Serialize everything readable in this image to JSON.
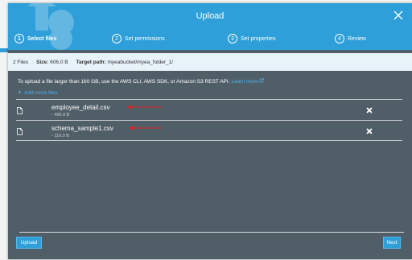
{
  "modal": {
    "title": "Upload",
    "steps": [
      {
        "num": "1",
        "label": "Select files"
      },
      {
        "num": "2",
        "label": "Set permissions"
      },
      {
        "num": "3",
        "label": "Set properties"
      },
      {
        "num": "4",
        "label": "Review"
      }
    ]
  },
  "summary": {
    "files": "2 Files",
    "size_label": "Size:",
    "size_value": "606.0 B",
    "path_label": "Target path:",
    "path_value": "myeabucket/myea_folder_1/"
  },
  "notice": {
    "text": "To upload a file larger than 160 GB, use the AWS CLI, AWS SDK, or Amazon S3 REST API.",
    "link": "Learn more"
  },
  "add_more": "Add more files",
  "files": [
    {
      "name": "employee_detail.csv",
      "size": "- 496.0 B"
    },
    {
      "name": "schema_sample1.csv",
      "size": "- 110.0 B"
    }
  ],
  "buttons": {
    "upload": "Upload",
    "next": "Next"
  },
  "colors": {
    "header": "#2e9fd8",
    "body": "#505e68",
    "info_bar": "#e8f3f9",
    "link": "#4ab1ea",
    "annotation_arrow": "#e0231c"
  }
}
